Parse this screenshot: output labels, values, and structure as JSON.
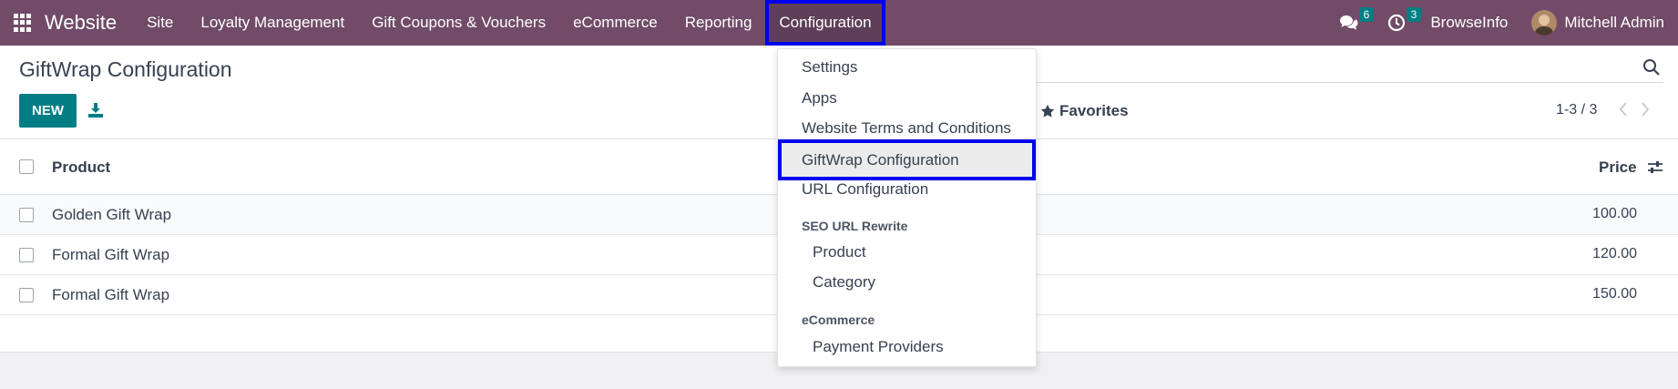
{
  "navbar": {
    "brand": "Website",
    "menu": [
      "Site",
      "Loyalty Management",
      "Gift Coupons & Vouchers",
      "eCommerce",
      "Reporting",
      "Configuration"
    ],
    "messages_badge": "6",
    "activities_badge": "3",
    "company": "BrowseInfo",
    "user": "Mitchell Admin"
  },
  "control_panel": {
    "title": "GiftWrap Configuration",
    "new_label": "NEW",
    "favorites_label": "Favorites",
    "pager": "1-3 / 3"
  },
  "list": {
    "columns": {
      "product": "Product",
      "price": "Price"
    },
    "rows": [
      {
        "product": "Golden Gift Wrap",
        "price": "100.00"
      },
      {
        "product": "Formal Gift Wrap",
        "price": "120.00"
      },
      {
        "product": "Formal Gift Wrap",
        "price": "150.00"
      }
    ]
  },
  "dropdown": {
    "items": [
      "Settings",
      "Apps",
      "Website Terms and Conditions",
      "GiftWrap Configuration",
      "URL Configuration"
    ],
    "seo_header": "SEO URL Rewrite",
    "seo_items": [
      "Product",
      "Category"
    ],
    "ecommerce_header": "eCommerce",
    "ecommerce_items": [
      "Payment Providers"
    ]
  },
  "colors": {
    "navbar": "#714b67",
    "primary": "#017e84",
    "highlight": "#0000ee"
  },
  "icons": [
    "apps-grid-icon",
    "download-icon",
    "search-icon",
    "star-icon",
    "chevron-left-icon",
    "chevron-right-icon",
    "chat-icon",
    "clock-icon",
    "sliders-icon"
  ]
}
